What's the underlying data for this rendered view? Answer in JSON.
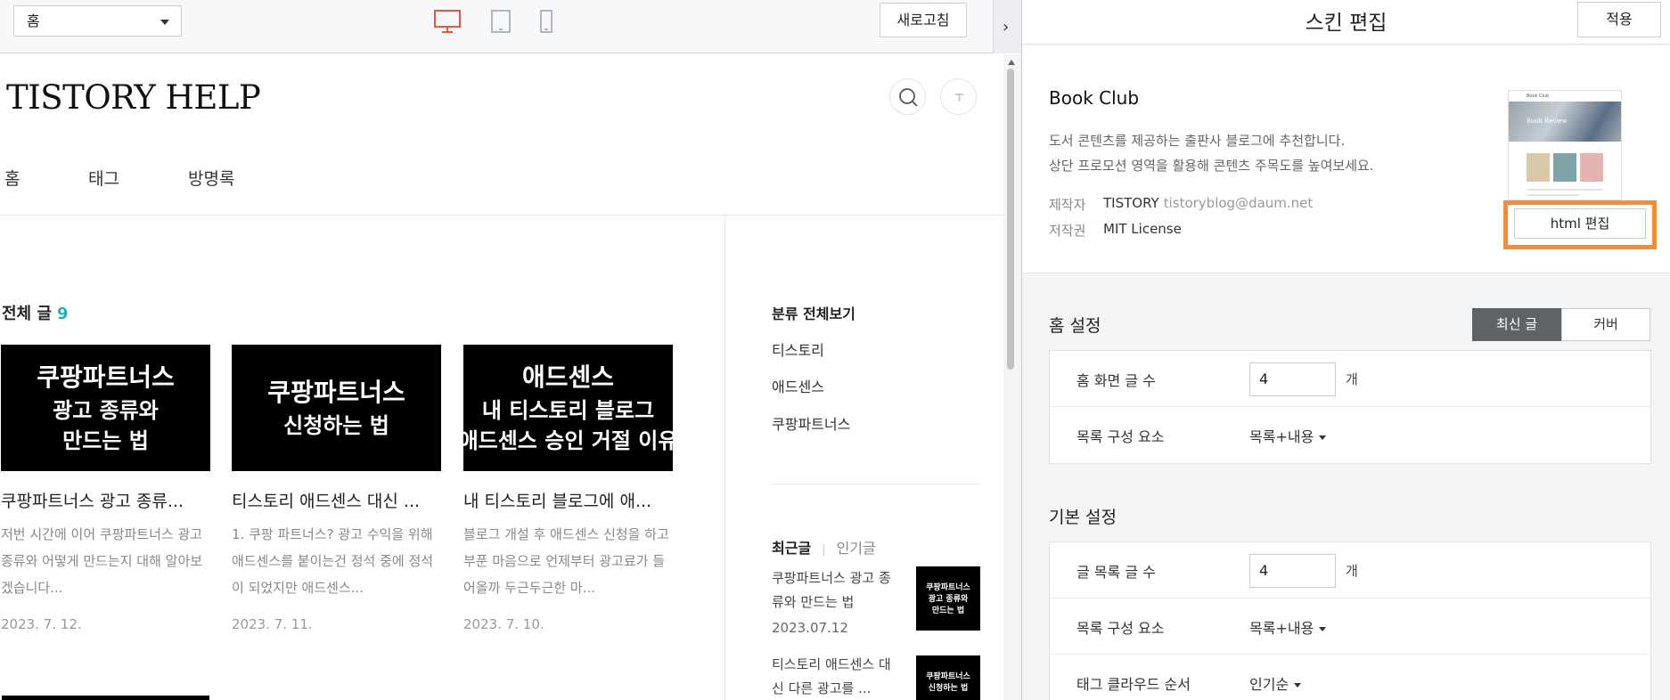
{
  "toolbar": {
    "page_select": "홈",
    "refresh_label": "새로고침",
    "collapse_glyph": "›"
  },
  "blog": {
    "title": "TISTORY HELP",
    "nav": [
      "홈",
      "태그",
      "방명록"
    ],
    "all_posts_label": "전체 글",
    "all_posts_count": "9",
    "posts": [
      {
        "thumb_l1": "쿠팡파트너스",
        "thumb_l2": "광고 종류와",
        "thumb_l3": "만드는 법",
        "title": "쿠팡파트너스 광고 종류...",
        "excerpt": "저번 시간에 이어 쿠팡파트너스 광고 종류와 어떻게 만드는지 대해 알아보겠습니다...",
        "date": "2023. 7. 12."
      },
      {
        "thumb_l1": "쿠팡파트너스",
        "thumb_l2": "신청하는 법",
        "thumb_l3": "",
        "title": "티스토리 애드센스 대신 ...",
        "excerpt": "1. 쿠팡 파트너스? 광고 수익을 위해 애드센스를 붙이는건 정석 중에 정석이 되었지만 애드센스...",
        "date": "2023. 7. 11."
      },
      {
        "thumb_l1": "애드센스",
        "thumb_l2": "내 티스토리 블로그",
        "thumb_l3": "애드센스 승인 거절 이유",
        "title": "내 티스토리 블로그에 애...",
        "excerpt": "블로그 개설 후 애드센스 신청을 하고 부푼 마음으로 언제부터 광고료가 들어올까 두근두근한 마...",
        "date": "2023. 7. 10."
      }
    ],
    "sidebar": {
      "category_all": "분류 전체보기",
      "categories": [
        "티스토리",
        "애드센스",
        "쿠팡파트너스"
      ],
      "tab_recent": "최근글",
      "tab_popular": "인기글",
      "recent": [
        {
          "title": "쿠팡파트너스 광고 종류와 만드는 법",
          "date": "2023.07.12",
          "thumb_l1": "쿠팡파트너스",
          "thumb_l2": "광고 종류와",
          "thumb_l3": "만드는 법"
        },
        {
          "title": "티스토리 애드센스 대신 다른 광고를 ...",
          "date": "",
          "thumb_l1": "쿠팡파트너스",
          "thumb_l2": "신청하는 법",
          "thumb_l3": ""
        }
      ]
    }
  },
  "panel": {
    "title": "스킨 편집",
    "apply_label": "적용",
    "skin": {
      "name": "Book Club",
      "desc1": "도서 콘텐츠를 제공하는 출판사 블로그에 추천합니다.",
      "desc2": "상단 프로모션 영역을 활용해 콘텐츠 주목도를 높여보세요.",
      "author_label": "제작자",
      "author": "TISTORY",
      "email": "tistoryblog@daum.net",
      "license_label": "저작권",
      "license": "MIT License",
      "thumb_caption": "Book Review",
      "thumb_brand": "Book Club",
      "html_edit_label": "html 편집"
    },
    "home": {
      "title": "홈 설정",
      "toggle": [
        "최신 글",
        "커버"
      ],
      "rows": [
        {
          "label": "홈 화면 글 수",
          "value": "4",
          "unit": "개"
        },
        {
          "label": "목록 구성 요소",
          "select": "목록+내용"
        }
      ]
    },
    "basic": {
      "title": "기본 설정",
      "rows": [
        {
          "label": "글 목록 글 수",
          "value": "4",
          "unit": "개"
        },
        {
          "label": "목록 구성 요소",
          "select": "목록+내용"
        },
        {
          "label": "태그 클라우드 순서",
          "select": "인기순"
        }
      ]
    }
  },
  "colors": {
    "accent_orange": "#ff8a2a",
    "count_teal": "#1fb3b7",
    "device_active": "#e8553e"
  }
}
